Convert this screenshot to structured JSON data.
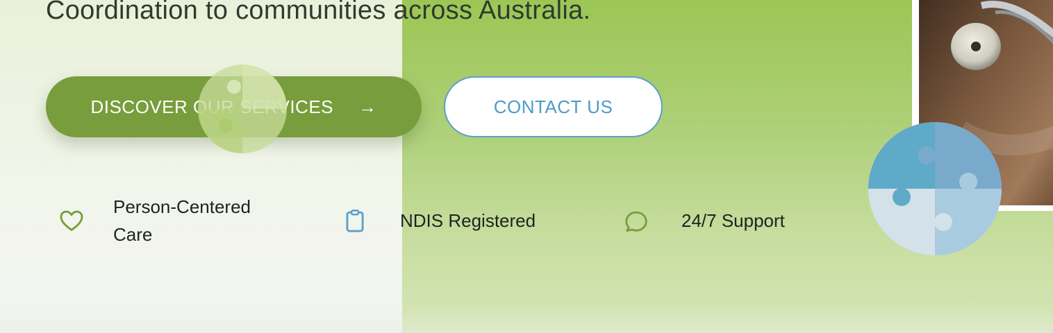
{
  "hero": {
    "subtitle": "Coordination to communities across Australia.",
    "primary_button": {
      "label": "DISCOVER OUR SERVICES",
      "arrow": "→"
    },
    "secondary_button": {
      "label": "CONTACT US"
    }
  },
  "features": [
    {
      "icon": "heart-icon",
      "label": "Person-Centered Care"
    },
    {
      "icon": "clipboard-icon",
      "label": "NDIS Registered"
    },
    {
      "icon": "chat-bubble-icon",
      "label": "24/7 Support"
    }
  ],
  "colors": {
    "brand_green": "#789d3c",
    "accent_blue": "#4f9ac6",
    "hero_green": "#9cc654"
  }
}
